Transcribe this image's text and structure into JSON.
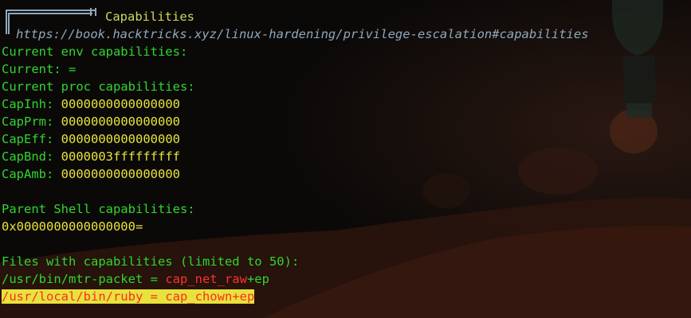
{
  "section": {
    "title": "Capabilities",
    "url": "https://book.hacktricks.xyz/linux-hardening/privilege-escalation#capabilities"
  },
  "env": {
    "header": "Current env capabilities:",
    "current": "Current: ="
  },
  "proc": {
    "header": "Current proc capabilities:",
    "rows": [
      {
        "name": "CapInh:",
        "value": "0000000000000000"
      },
      {
        "name": "CapPrm:",
        "value": "0000000000000000"
      },
      {
        "name": "CapEff:",
        "value": "0000000000000000"
      },
      {
        "name": "CapBnd:",
        "value": "0000003fffffffff"
      },
      {
        "name": "CapAmb:",
        "value": "0000000000000000"
      }
    ]
  },
  "parent": {
    "header": "Parent Shell capabilities:",
    "value": "0x0000000000000000="
  },
  "files": {
    "header": "Files with capabilities (limited to 50):",
    "entries": [
      {
        "path": "/usr/bin/mtr-packet",
        "sep": " = ",
        "cap": "cap_net_raw",
        "flags": "+ep"
      },
      {
        "text": "/usr/local/bin/ruby = cap_chown+ep"
      }
    ]
  },
  "colors": {
    "header_green": "#2fd62f",
    "value_yellow": "#e7e33b",
    "danger_red": "#ff3030",
    "url_blue": "#8fa8bb",
    "background": "#0b0908"
  }
}
